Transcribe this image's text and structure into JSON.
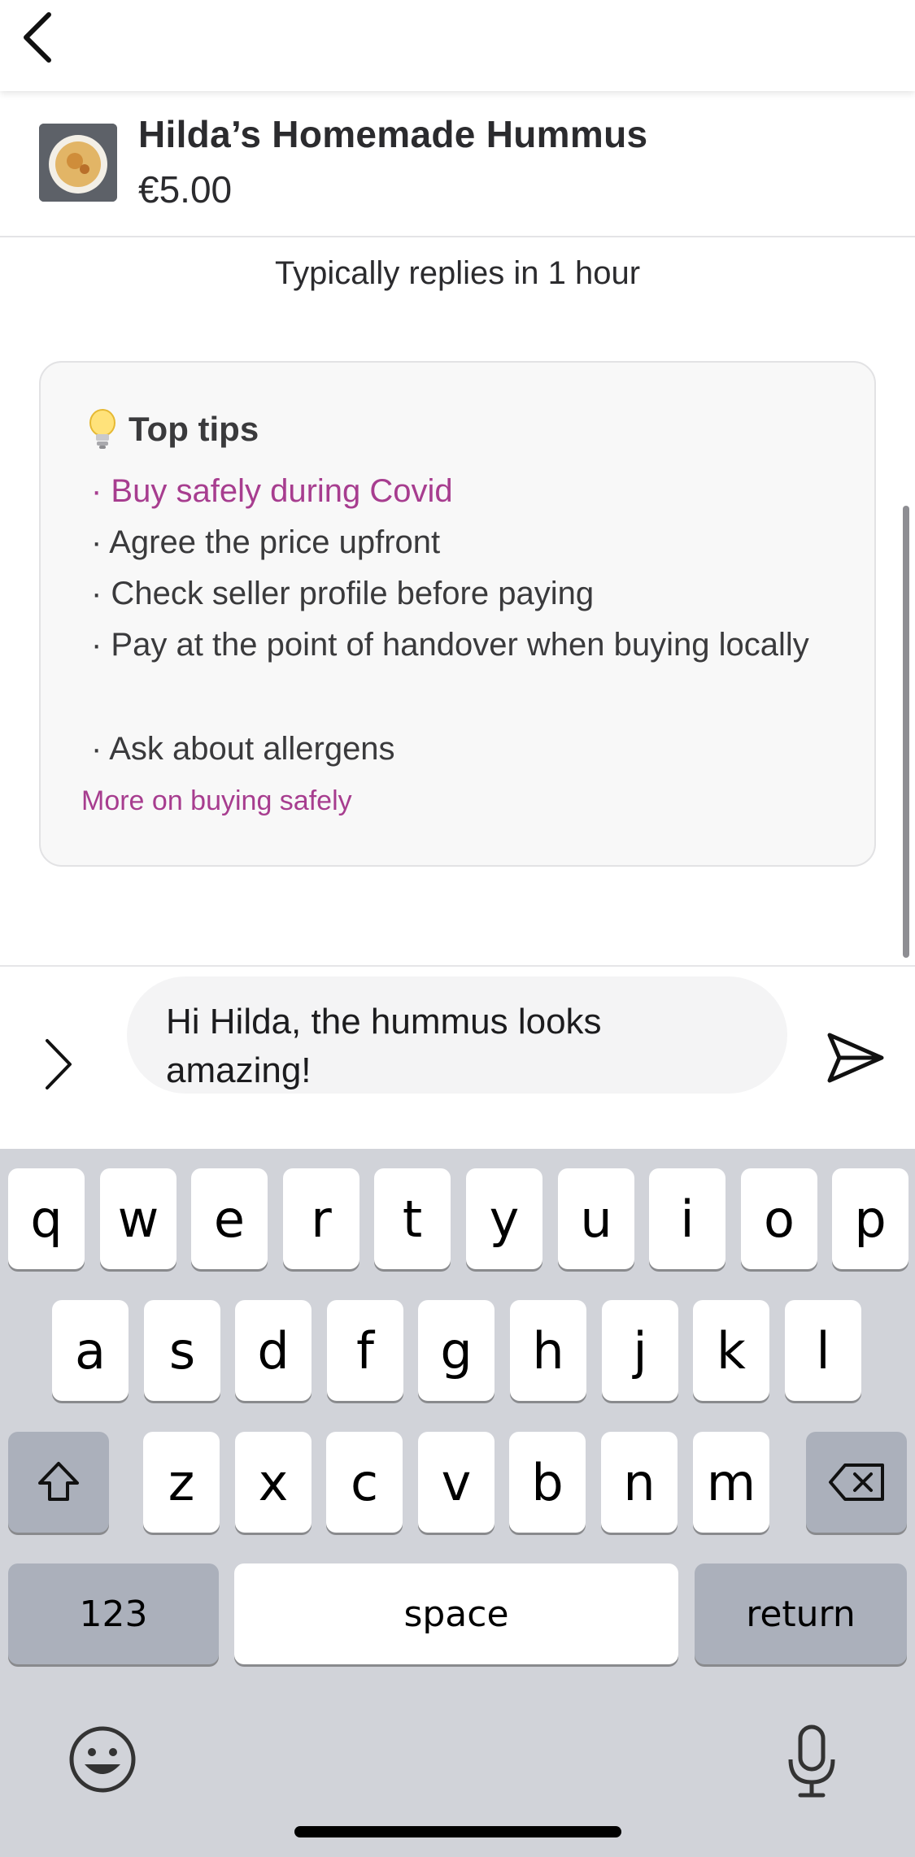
{
  "nav": {
    "back_icon": "chevron-left-icon"
  },
  "listing": {
    "title": "Hilda’s Homemade Hummus",
    "price": "€5.00"
  },
  "reply_time": "Typically replies in 1 hour",
  "tips": {
    "icon": "lightbulb-icon",
    "title": "Top tips",
    "items": [
      {
        "text": "· Buy safely during Covid",
        "accent": true
      },
      {
        "text": "· Agree the price upfront",
        "accent": false
      },
      {
        "text": "· Check seller profile before paying",
        "accent": false
      },
      {
        "text": "· Pay at the point of handover when buying locally",
        "accent": false
      },
      {
        "text": "· Ask about allergens",
        "accent": false
      }
    ],
    "more_link": "More on buying safely"
  },
  "composer": {
    "expand_icon": "chevron-right-icon",
    "message": "Hi Hilda, the hummus looks amazing!",
    "send_icon": "send-icon"
  },
  "keyboard": {
    "row1": [
      "q",
      "w",
      "e",
      "r",
      "t",
      "y",
      "u",
      "i",
      "o",
      "p"
    ],
    "row2": [
      "a",
      "s",
      "d",
      "f",
      "g",
      "h",
      "j",
      "k",
      "l"
    ],
    "row3": [
      "z",
      "x",
      "c",
      "v",
      "b",
      "n",
      "m"
    ],
    "numbers_label": "123",
    "space_label": "space",
    "return_label": "return",
    "shift_icon": "shift-icon",
    "delete_icon": "backspace-icon",
    "emoji_icon": "emoji-icon",
    "mic_icon": "microphone-icon"
  },
  "colors": {
    "accent": "#a73d8f",
    "keyboard_bg": "#d1d3d9",
    "key_dark": "#abb0bb"
  }
}
